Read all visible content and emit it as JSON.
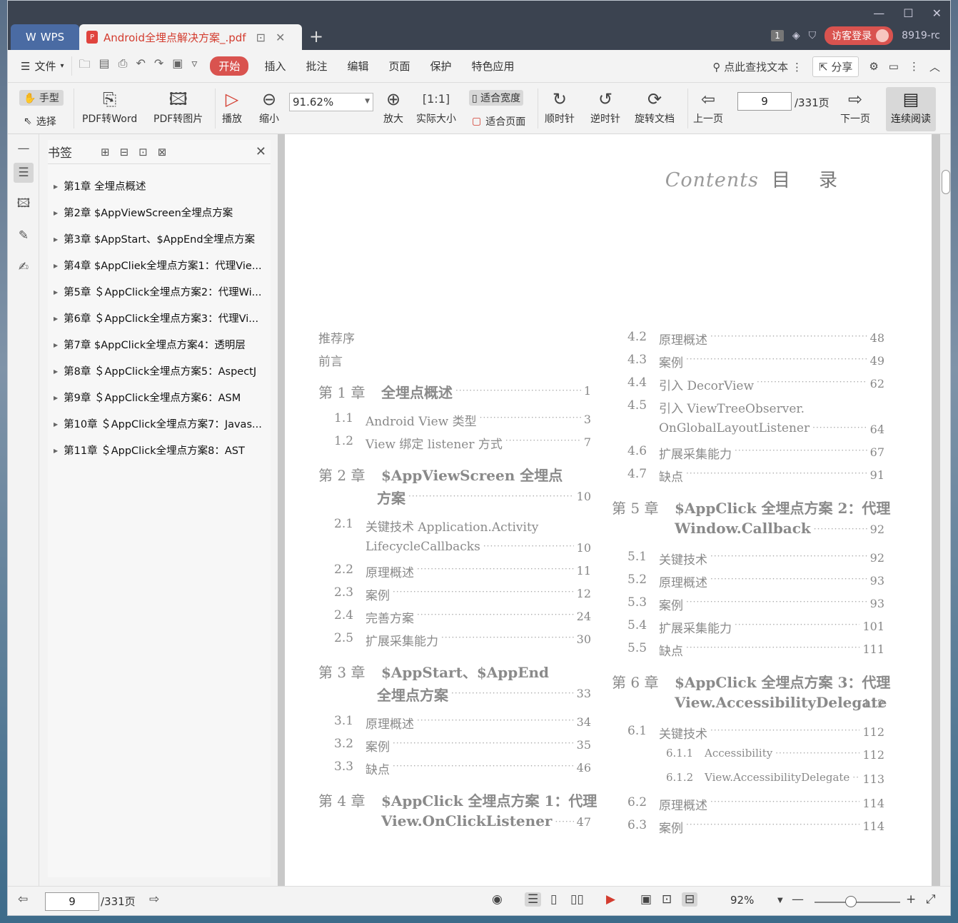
{
  "titlebar": {
    "app_tab": "WPS",
    "doc_tab": "Android全埋点解决方案_.pdf",
    "page_count_badge": "1",
    "guest_login": "访客登录",
    "user_id": "8919-rc"
  },
  "menu": {
    "file": "文件",
    "items": [
      "开始",
      "插入",
      "批注",
      "编辑",
      "页面",
      "保护",
      "特色应用"
    ],
    "search": "点此查找文本",
    "share": "分享"
  },
  "toolbar": {
    "hand": "手型",
    "select": "选择",
    "pdf_to_word": "PDF转Word",
    "pdf_to_image": "PDF转图片",
    "play": "播放",
    "zoom_out": "缩小",
    "zoom_value": "91.62%",
    "zoom_in": "放大",
    "actual_size": "实际大小",
    "fit_width": "适合宽度",
    "fit_page": "适合页面",
    "clockwise": "顺时针",
    "counterclockwise": "逆时针",
    "rotate_doc": "旋转文档",
    "prev_page": "上一页",
    "page_input": "9",
    "page_total": "/331页",
    "next_page": "下一页",
    "continuous": "连续阅读"
  },
  "panel": {
    "title": "书签",
    "bookmarks": [
      "第1章 全埋点概述",
      "第2章 $AppViewScreen全埋点方案",
      "第3章 $AppStart、$AppEnd全埋点方案",
      "第4章 $AppCliek全埋点方案1：代理Vie...",
      "第5章 ＄AppClick全埋点方案2：代理Wi...",
      "第6章 ＄AppClick全埋点方案3：代理Vi...",
      "第7章 $AppClick全埋点方案4：透明层",
      "第8章 ＄AppClick全埋点方案5：AspectJ",
      "第9章 ＄AppClick全埋点方案6：ASM",
      "第10章 ＄AppClick全埋点方案7：Javas...",
      "第11章 ＄AppClick全埋点方案8：AST"
    ]
  },
  "document": {
    "contents_script": "Contents",
    "contents_cn": "目录",
    "left_col": [
      {
        "kind": "front",
        "text": "推荐序",
        "page": ""
      },
      {
        "kind": "front",
        "text": "前言",
        "page": ""
      },
      {
        "kind": "ch",
        "num": "第 1 章",
        "text": "全埋点概述",
        "page": "1"
      },
      {
        "kind": "sec",
        "num": "1.1",
        "text": "Android View 类型",
        "page": "3"
      },
      {
        "kind": "sec",
        "num": "1.2",
        "text": "View 绑定 listener 方式",
        "page": "7"
      },
      {
        "kind": "ch",
        "num": "第 2 章",
        "text": "$AppViewScreen 全埋点",
        "text2": "方案",
        "page": "10"
      },
      {
        "kind": "sec",
        "num": "2.1",
        "text": "关键技术 Application.Activity",
        "text2": "LifecycleCallbacks",
        "page": "10"
      },
      {
        "kind": "sec",
        "num": "2.2",
        "text": "原理概述",
        "page": "11"
      },
      {
        "kind": "sec",
        "num": "2.3",
        "text": "案例",
        "page": "12"
      },
      {
        "kind": "sec",
        "num": "2.4",
        "text": "完善方案",
        "page": "24"
      },
      {
        "kind": "sec",
        "num": "2.5",
        "text": "扩展采集能力",
        "page": "30"
      },
      {
        "kind": "ch",
        "num": "第 3 章",
        "text": "$AppStart、$AppEnd",
        "text2": "全埋点方案",
        "page": "33"
      },
      {
        "kind": "sec",
        "num": "3.1",
        "text": "原理概述",
        "page": "34"
      },
      {
        "kind": "sec",
        "num": "3.2",
        "text": "案例",
        "page": "35"
      },
      {
        "kind": "sec",
        "num": "3.3",
        "text": "缺点",
        "page": "46"
      },
      {
        "kind": "ch",
        "num": "第 4 章",
        "text": "$AppClick 全埋点方案 1：代理",
        "text2": "View.OnClickListener",
        "page": "47"
      }
    ],
    "right_col": [
      {
        "kind": "sec",
        "num": "4.2",
        "text": "原理概述",
        "page": "48"
      },
      {
        "kind": "sec",
        "num": "4.3",
        "text": "案例",
        "page": "49"
      },
      {
        "kind": "sec",
        "num": "4.4",
        "text": "引入 DecorView",
        "page": "62"
      },
      {
        "kind": "sec",
        "num": "4.5",
        "text": "引入 ViewTreeObserver.",
        "text2": "OnGlobalLayoutListener",
        "page": "64"
      },
      {
        "kind": "sec",
        "num": "4.6",
        "text": "扩展采集能力",
        "page": "67"
      },
      {
        "kind": "sec",
        "num": "4.7",
        "text": "缺点",
        "page": "91"
      },
      {
        "kind": "ch",
        "num": "第 5 章",
        "text": "$AppClick 全埋点方案 2：代理",
        "text2": "Window.Callback",
        "page": "92"
      },
      {
        "kind": "sec",
        "num": "5.1",
        "text": "关键技术",
        "page": "92"
      },
      {
        "kind": "sec",
        "num": "5.2",
        "text": "原理概述",
        "page": "93"
      },
      {
        "kind": "sec",
        "num": "5.3",
        "text": "案例",
        "page": "93"
      },
      {
        "kind": "sec",
        "num": "5.4",
        "text": "扩展采集能力",
        "page": "101"
      },
      {
        "kind": "sec",
        "num": "5.5",
        "text": "缺点",
        "page": "111"
      },
      {
        "kind": "ch",
        "num": "第 6 章",
        "text": "$AppClick 全埋点方案 3：代理",
        "text2": "View.AccessibilityDelegate",
        "page": "112"
      },
      {
        "kind": "sec",
        "num": "6.1",
        "text": "关键技术",
        "page": "112"
      },
      {
        "kind": "sub",
        "num": "6.1.1",
        "text": "Accessibility",
        "page": "112"
      },
      {
        "kind": "sub",
        "num": "6.1.2",
        "text": "View.AccessibilityDelegate",
        "page": "113"
      },
      {
        "kind": "sec",
        "num": "6.2",
        "text": "原理概述",
        "page": "114"
      },
      {
        "kind": "sec",
        "num": "6.3",
        "text": "案例",
        "page": "114"
      }
    ]
  },
  "status": {
    "page_input": "9",
    "page_total": "/331页",
    "zoom": "92%"
  }
}
